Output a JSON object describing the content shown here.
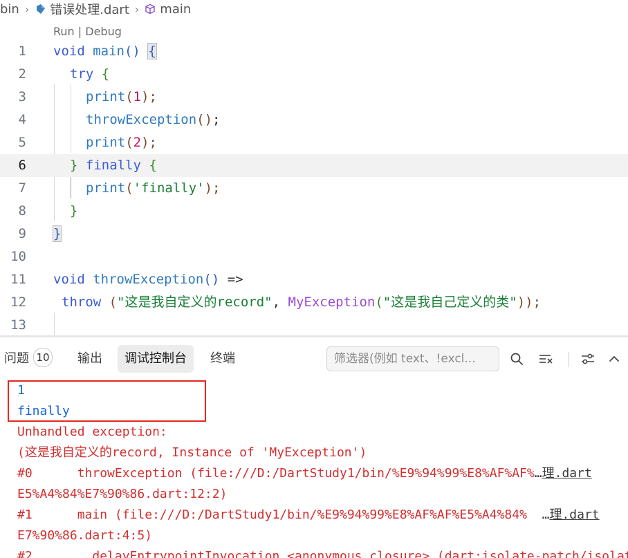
{
  "breadcrumb": {
    "folder": "bin",
    "file": "错误处理.dart",
    "symbol": "main"
  },
  "codelens": {
    "run": "Run",
    "sep": " | ",
    "debug": "Debug"
  },
  "line_numbers": [
    "1",
    "2",
    "3",
    "4",
    "5",
    "6",
    "7",
    "8",
    "9",
    "10",
    "11",
    "12",
    "13"
  ],
  "code": {
    "l1": {
      "kw": "void",
      "fn": "main",
      "p": "()",
      "sp": " ",
      "br": "{"
    },
    "l2": {
      "kw": "try",
      "br": "{"
    },
    "l3": {
      "fn": "print",
      "open": "(",
      "num": "1",
      "close": ");"
    },
    "l4": {
      "fn": "throwException",
      "paren": "()",
      "semi": ";"
    },
    "l5": {
      "fn": "print",
      "open": "(",
      "num": "2",
      "close": ");"
    },
    "l6": {
      "br1": "}",
      "kw": "finally",
      "br2": "{"
    },
    "l7": {
      "fn": "print",
      "open": "(",
      "str": "'finally'",
      "close": ");"
    },
    "l8": {
      "br": "}"
    },
    "l9": {
      "br": "}"
    },
    "l11": {
      "kw": "void",
      "fn": "throwException",
      "paren": "()",
      "arrow": "=>"
    },
    "l12": {
      "kw": "throw",
      "open": "(",
      "str1": "\"这是我自定义的record\"",
      "comma": ",",
      "cls": "MyException",
      "open2": "(",
      "str2": "\"这是我自己定义的类\"",
      "close": "));"
    }
  },
  "panel": {
    "tabs": [
      {
        "label": "问题",
        "badge": "10"
      },
      {
        "label": "输出"
      },
      {
        "label": "调试控制台"
      },
      {
        "label": "终端"
      }
    ],
    "filter_placeholder": "筛选器(例如 text、!excl...",
    "icons": [
      "search-icon",
      "clear-console-icon",
      "settings-icon",
      "chevron-up-icon"
    ]
  },
  "console": {
    "output": [
      "1",
      "finally"
    ],
    "error_header": "Unhandled exception:",
    "error_message": "(这是我自定义的record, Instance of 'MyException')",
    "frames": [
      {
        "id": "#0",
        "text": "      throwException (file:///D:/DartStudy1/bin/%E9%94%99%E8%AF%AF%",
        "ellipsis": "…",
        "link": "理.dart",
        "cont": "E5%A4%84%E7%90%86.dart:12:2)"
      },
      {
        "id": "#1",
        "text": "      main (file:///D:/DartStudy1/bin/%E9%94%99%E8%AF%AF%E5%A4%84%  ",
        "ellipsis": "…",
        "link": "理.dart",
        "cont": "E7%90%86.dart:4:5)"
      },
      {
        "id": "#2",
        "text": "       _delayEntrypointInvocation.<anonymous closure> (dart:isolate-patch/isolate_patch.dart"
      }
    ]
  },
  "colors": {
    "accent": "#1a66d6",
    "error": "#d32f2f",
    "highlight_box": "#e8261e"
  }
}
